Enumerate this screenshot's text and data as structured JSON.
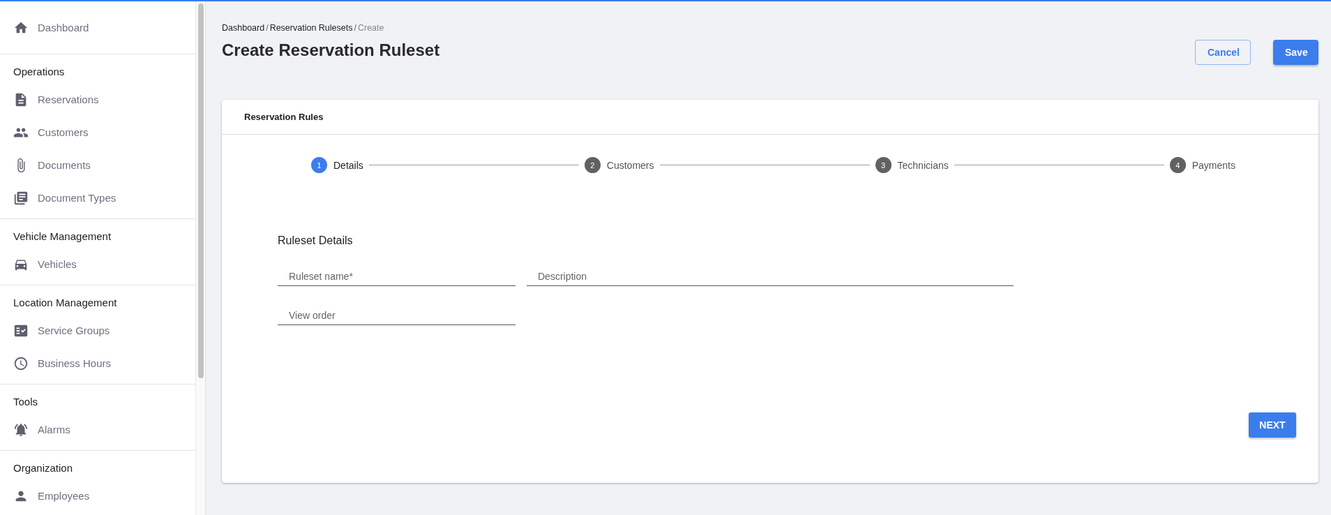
{
  "sidebar": {
    "sections": [
      {
        "items": [
          {
            "label": "Dashboard"
          }
        ]
      },
      {
        "heading": "Operations",
        "items": [
          {
            "label": "Reservations"
          },
          {
            "label": "Customers"
          },
          {
            "label": "Documents"
          },
          {
            "label": "Document Types"
          }
        ]
      },
      {
        "heading": "Vehicle Management",
        "items": [
          {
            "label": "Vehicles"
          }
        ]
      },
      {
        "heading": "Location Management",
        "items": [
          {
            "label": "Service Groups"
          },
          {
            "label": "Business Hours"
          }
        ]
      },
      {
        "heading": "Tools",
        "items": [
          {
            "label": "Alarms"
          }
        ]
      },
      {
        "heading": "Organization",
        "items": [
          {
            "label": "Employees"
          }
        ]
      }
    ]
  },
  "breadcrumb": [
    {
      "label": "Dashboard",
      "current": false
    },
    {
      "label": "Reservation Rulesets",
      "current": false
    },
    {
      "label": "Create",
      "current": true
    }
  ],
  "breadcrumb_separator": "/",
  "page_title": "Create Reservation Ruleset",
  "header_buttons": [
    {
      "label": "Cancel",
      "kind": "outlined"
    },
    {
      "label": "Save",
      "kind": "filled"
    }
  ],
  "card": {
    "title": "Reservation Rules",
    "steps": [
      {
        "number": "1",
        "label": "Details",
        "selected": true
      },
      {
        "number": "2",
        "label": "Customers",
        "selected": false
      },
      {
        "number": "3",
        "label": "Technicians",
        "selected": false
      },
      {
        "number": "4",
        "label": "Payments",
        "selected": false
      }
    ],
    "section_title": "Ruleset Details",
    "fields": [
      [
        {
          "placeholder": "Ruleset name*",
          "wide": false
        },
        {
          "placeholder": "Description",
          "wide": true
        }
      ],
      [
        {
          "placeholder": "View order",
          "wide": false
        }
      ]
    ],
    "next_button": "NEXT"
  }
}
